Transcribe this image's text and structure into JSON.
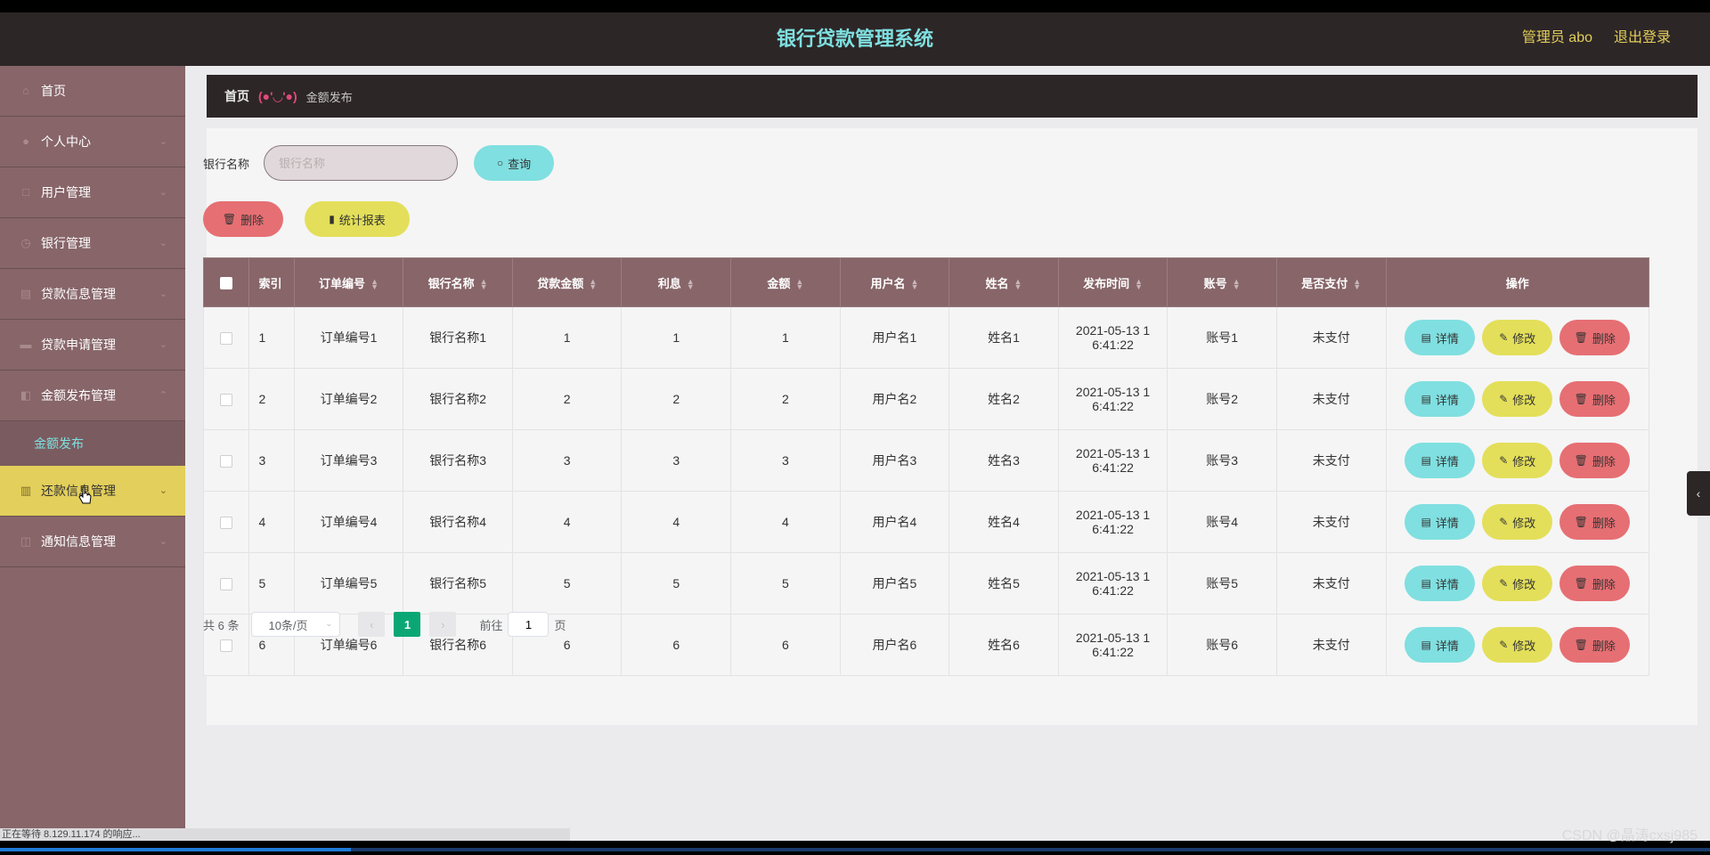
{
  "header": {
    "title": "银行贷款管理系统",
    "admin_label": "管理员 abo",
    "logout_label": "退出登录"
  },
  "sidebar": {
    "items": [
      {
        "label": "首页",
        "icon": "home-icon"
      },
      {
        "label": "个人中心",
        "icon": "user-icon"
      },
      {
        "label": "用户管理",
        "icon": "users-icon"
      },
      {
        "label": "银行管理",
        "icon": "bank-icon"
      },
      {
        "label": "贷款信息管理",
        "icon": "document-icon"
      },
      {
        "label": "贷款申请管理",
        "icon": "form-icon"
      },
      {
        "label": "金额发布管理",
        "icon": "money-icon"
      },
      {
        "label": "还款信息管理",
        "icon": "chart-icon"
      },
      {
        "label": "通知信息管理",
        "icon": "bell-icon"
      }
    ],
    "submenu_label": "金额发布"
  },
  "breadcrumb": {
    "home": "首页",
    "separator": "(●'◡'●)",
    "current": "金额发布"
  },
  "search": {
    "label": "银行名称",
    "placeholder": "银行名称",
    "query_label": "查询"
  },
  "actions": {
    "delete_label": "删除",
    "report_label": "统计报表"
  },
  "table": {
    "columns": [
      "索引",
      "订单编号",
      "银行名称",
      "贷款金额",
      "利息",
      "金额",
      "用户名",
      "姓名",
      "发布时间",
      "账号",
      "是否支付",
      "操作"
    ],
    "rows": [
      {
        "index": "1",
        "order_no": "订单编号1",
        "bank": "银行名称1",
        "loan": "1",
        "interest": "1",
        "amount": "1",
        "username": "用户名1",
        "name": "姓名1",
        "time_line1": "2021-05-13 1",
        "time_line2": "6:41:22",
        "account": "账号1",
        "paid": "未支付"
      },
      {
        "index": "2",
        "order_no": "订单编号2",
        "bank": "银行名称2",
        "loan": "2",
        "interest": "2",
        "amount": "2",
        "username": "用户名2",
        "name": "姓名2",
        "time_line1": "2021-05-13 1",
        "time_line2": "6:41:22",
        "account": "账号2",
        "paid": "未支付"
      },
      {
        "index": "3",
        "order_no": "订单编号3",
        "bank": "银行名称3",
        "loan": "3",
        "interest": "3",
        "amount": "3",
        "username": "用户名3",
        "name": "姓名3",
        "time_line1": "2021-05-13 1",
        "time_line2": "6:41:22",
        "account": "账号3",
        "paid": "未支付"
      },
      {
        "index": "4",
        "order_no": "订单编号4",
        "bank": "银行名称4",
        "loan": "4",
        "interest": "4",
        "amount": "4",
        "username": "用户名4",
        "name": "姓名4",
        "time_line1": "2021-05-13 1",
        "time_line2": "6:41:22",
        "account": "账号4",
        "paid": "未支付"
      },
      {
        "index": "5",
        "order_no": "订单编号5",
        "bank": "银行名称5",
        "loan": "5",
        "interest": "5",
        "amount": "5",
        "username": "用户名5",
        "name": "姓名5",
        "time_line1": "2021-05-13 1",
        "time_line2": "6:41:22",
        "account": "账号5",
        "paid": "未支付"
      },
      {
        "index": "6",
        "order_no": "订单编号6",
        "bank": "银行名称6",
        "loan": "6",
        "interest": "6",
        "amount": "6",
        "username": "用户名6",
        "name": "姓名6",
        "time_line1": "2021-05-13 1",
        "time_line2": "6:41:22",
        "account": "账号6",
        "paid": "未支付"
      }
    ],
    "op_labels": {
      "detail": "详情",
      "edit": "修改",
      "delete": "删除"
    }
  },
  "pagination": {
    "total": "共 6 条",
    "page_size": "10条/页",
    "current_page": "1",
    "goto_label": "前往",
    "goto_value": "1",
    "page_suffix": "页"
  },
  "status_bar": "正在等待 8.129.11.174 的响应...",
  "watermark": "CSDN @晶涛cxsj985",
  "colors": {
    "header_bg": "#2d2627",
    "title_color": "#7fe0e0",
    "sidebar_bg": "#876569",
    "active_item": "#e3cf5b",
    "btn_cyan": "#80dfe0",
    "btn_yellow": "#e3df5a",
    "btn_red": "#e66f73",
    "page_active": "#0aa775"
  }
}
